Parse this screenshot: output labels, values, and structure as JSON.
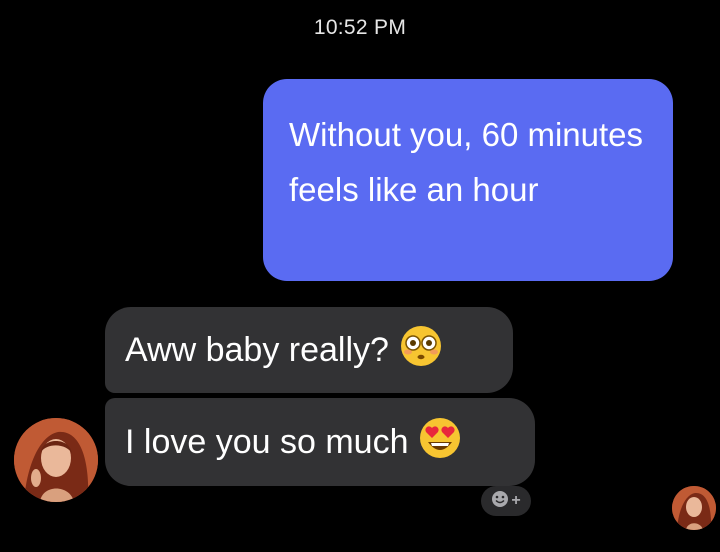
{
  "header": {
    "time": "10:52 PM"
  },
  "messages": {
    "outgoing": [
      {
        "text": "Without you, 60 minutes feels like an hour"
      }
    ],
    "incoming": [
      {
        "text": "Aww baby really?",
        "emoji": "flushed-face-icon"
      },
      {
        "text": "I love you so much",
        "emoji": "heart-eyes-face-icon"
      }
    ]
  },
  "reaction_button": {
    "icon": "smiley-icon",
    "plus": "+"
  },
  "colors": {
    "background": "#000000",
    "outgoing_bubble": "#5a6bf2",
    "incoming_bubble": "#323234"
  }
}
